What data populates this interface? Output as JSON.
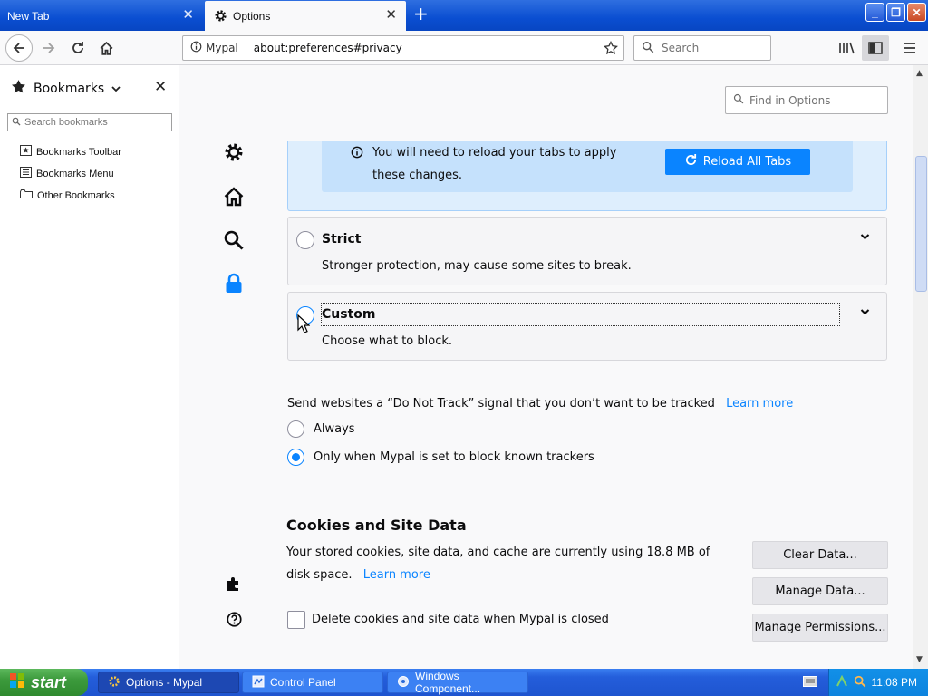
{
  "window": {
    "tabs": [
      {
        "label": "New Tab",
        "active": false
      },
      {
        "label": "Options",
        "active": true
      }
    ],
    "controls": {
      "minimize": "_",
      "maximize": "❐",
      "close": "✕"
    }
  },
  "toolbar": {
    "identity_label": "Mypal",
    "url": "about:preferences#privacy",
    "search_placeholder": "Search"
  },
  "sidebar": {
    "title": "Bookmarks",
    "search_placeholder": "Search bookmarks",
    "items": [
      {
        "label": "Bookmarks Toolbar",
        "icon": "toolbar-icon"
      },
      {
        "label": "Bookmarks Menu",
        "icon": "menu-icon"
      },
      {
        "label": "Other Bookmarks",
        "icon": "folder-icon"
      }
    ]
  },
  "content": {
    "find_placeholder": "Find in Options",
    "reload_notice": "You will need to reload your tabs to apply these changes.",
    "reload_button": "Reload All Tabs",
    "options": [
      {
        "label": "Strict",
        "description": "Stronger protection, may cause some sites to break."
      },
      {
        "label": "Custom",
        "description": "Choose what to block."
      }
    ],
    "dnt": {
      "text": "Send websites a “Do Not Track” signal that you don’t want to be tracked",
      "learn_more": "Learn more",
      "choices": [
        {
          "label": "Always",
          "checked": false
        },
        {
          "label": "Only when Mypal is set to block known trackers",
          "checked": true
        }
      ]
    },
    "cookies": {
      "heading": "Cookies and Site Data",
      "description": "Your stored cookies, site data, and cache are currently using 18.8 MB of disk space.",
      "learn_more": "Learn more",
      "buttons": [
        "Clear Data...",
        "Manage Data...",
        "Manage Permissions..."
      ],
      "delete_label": "Delete cookies and site data when Mypal is closed"
    }
  },
  "taskbar": {
    "start": "start",
    "tasks": [
      {
        "label": "Options - Mypal",
        "active": true
      },
      {
        "label": "Control Panel",
        "active": false
      },
      {
        "label": "Windows Component...",
        "active": false
      }
    ],
    "clock": "11:08 PM"
  },
  "colors": {
    "accent": "#0a84ff",
    "titlebar": "#0a4ed1",
    "notice_bg": "#deeefd"
  }
}
